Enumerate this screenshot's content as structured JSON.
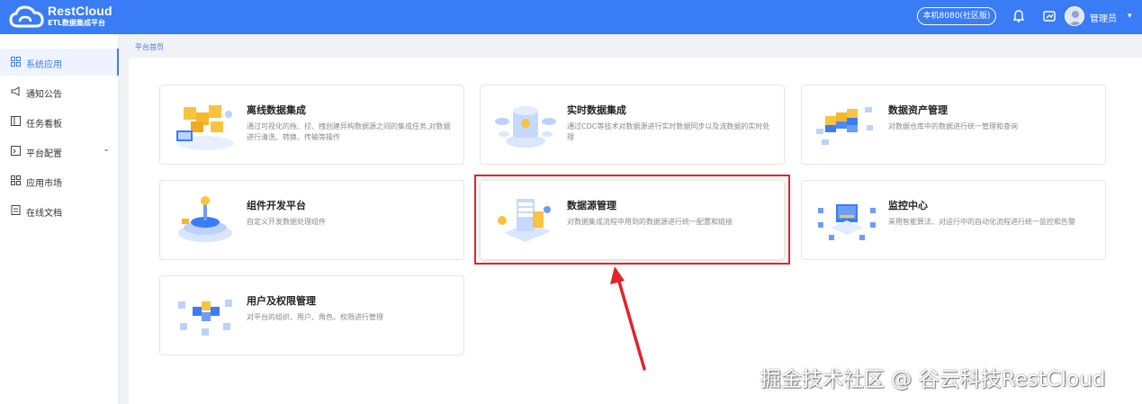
{
  "header": {
    "logo_title": "RestCloud",
    "logo_subtitle": "ETL数据集成平台",
    "env_label": "本机8080(社区版)",
    "user_name": "管理员",
    "user_caret": "▾",
    "brand_color": "#3a7cf5"
  },
  "sidebar": {
    "items": [
      {
        "label": "系统应用",
        "icon": "grid-icon",
        "active": true
      },
      {
        "label": "通知公告",
        "icon": "megaphone-icon"
      },
      {
        "label": "任务看板",
        "icon": "board-icon"
      },
      {
        "label": "平台配置",
        "icon": "terminal-icon",
        "caret": "⌄"
      },
      {
        "label": "应用市场",
        "icon": "grid-icon"
      },
      {
        "label": "在线文档",
        "icon": "document-icon"
      }
    ]
  },
  "breadcrumb": "平台首页",
  "cards": [
    {
      "title": "离线数据集成",
      "desc": "通过可视化的拖、拉、拽创建异构数据源之间的集成任务,对数据进行清洗、转换、传输等操作"
    },
    {
      "title": "实时数据集成",
      "desc": "通过CDC等技术对数据源进行实时数据同步以及流数据的实时处理"
    },
    {
      "title": "数据资产管理",
      "desc": "对数据仓库中的数据进行统一管理和查询"
    },
    {
      "title": "组件开发平台",
      "desc": "自定义开发数据处理组件"
    },
    {
      "title": "数据源管理",
      "desc": "对数据集成流程中用到的数据源进行统一配置和链接"
    },
    {
      "title": "监控中心",
      "desc": "采用智能算法、对运行中的自动化流程进行统一监控和告警"
    },
    {
      "title": "用户及权限管理",
      "desc": "对平台的组织、用户、角色、权限进行管理"
    }
  ],
  "watermark": "掘金技术社区 @ 谷云科技RestCloud",
  "highlight_color": "#e2232a"
}
